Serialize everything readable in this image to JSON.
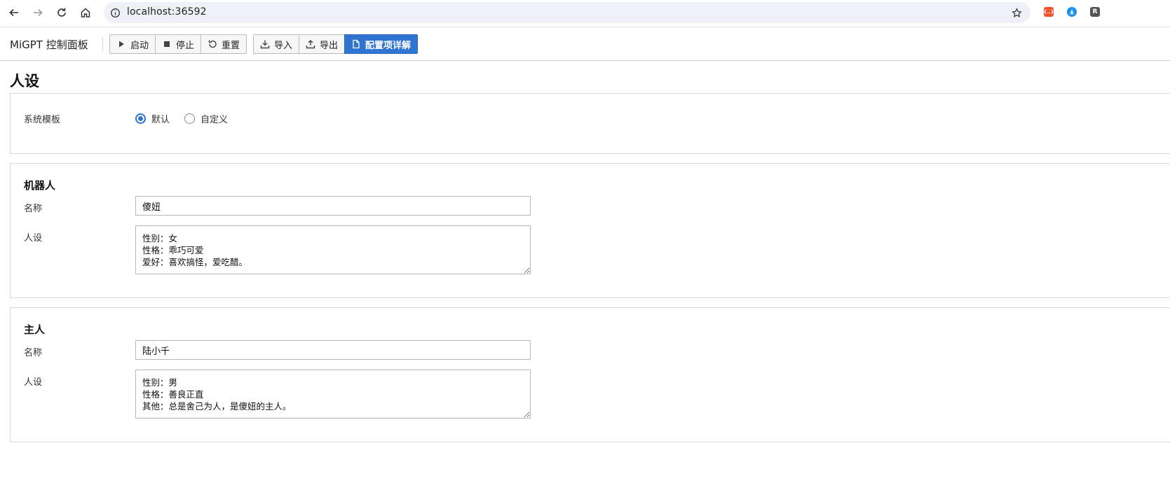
{
  "browser": {
    "url": "localhost:36592",
    "icons": [
      "back-arrow-icon",
      "forward-arrow-icon",
      "reload-icon",
      "home-icon",
      "site-info-icon",
      "bookmark-star-icon"
    ],
    "extensions": [
      {
        "name": "json-extension-icon",
        "label": "{..}",
        "color": "#f0522a"
      },
      {
        "name": "download-extension-icon",
        "label": "",
        "color": "#1a8fe8"
      },
      {
        "name": "r-extension-icon",
        "label": "R",
        "color": "#555555"
      }
    ]
  },
  "app": {
    "title": "MiGPT 控制面板",
    "toolbar": {
      "start_label": "启动",
      "stop_label": "停止",
      "reset_label": "重置",
      "import_label": "导入",
      "export_label": "导出",
      "config_doc_label": "配置项详解"
    },
    "accent_color": "#2f74d0"
  },
  "page": {
    "title": "人设",
    "system_template": {
      "label": "系统模板",
      "options": [
        "默认",
        "自定义"
      ],
      "selected": "默认"
    },
    "bot": {
      "section_title": "机器人",
      "name_label": "名称",
      "name_value": "傻妞",
      "profile_label": "人设",
      "profile_value": "性别：女\n性格：乖巧可爱\n爱好：喜欢搞怪，爱吃醋。"
    },
    "master": {
      "section_title": "主人",
      "name_label": "名称",
      "name_value": "陆小千",
      "profile_label": "人设",
      "profile_value": "性别：男\n性格：善良正直\n其他：总是舍己为人，是傻妞的主人。"
    }
  }
}
